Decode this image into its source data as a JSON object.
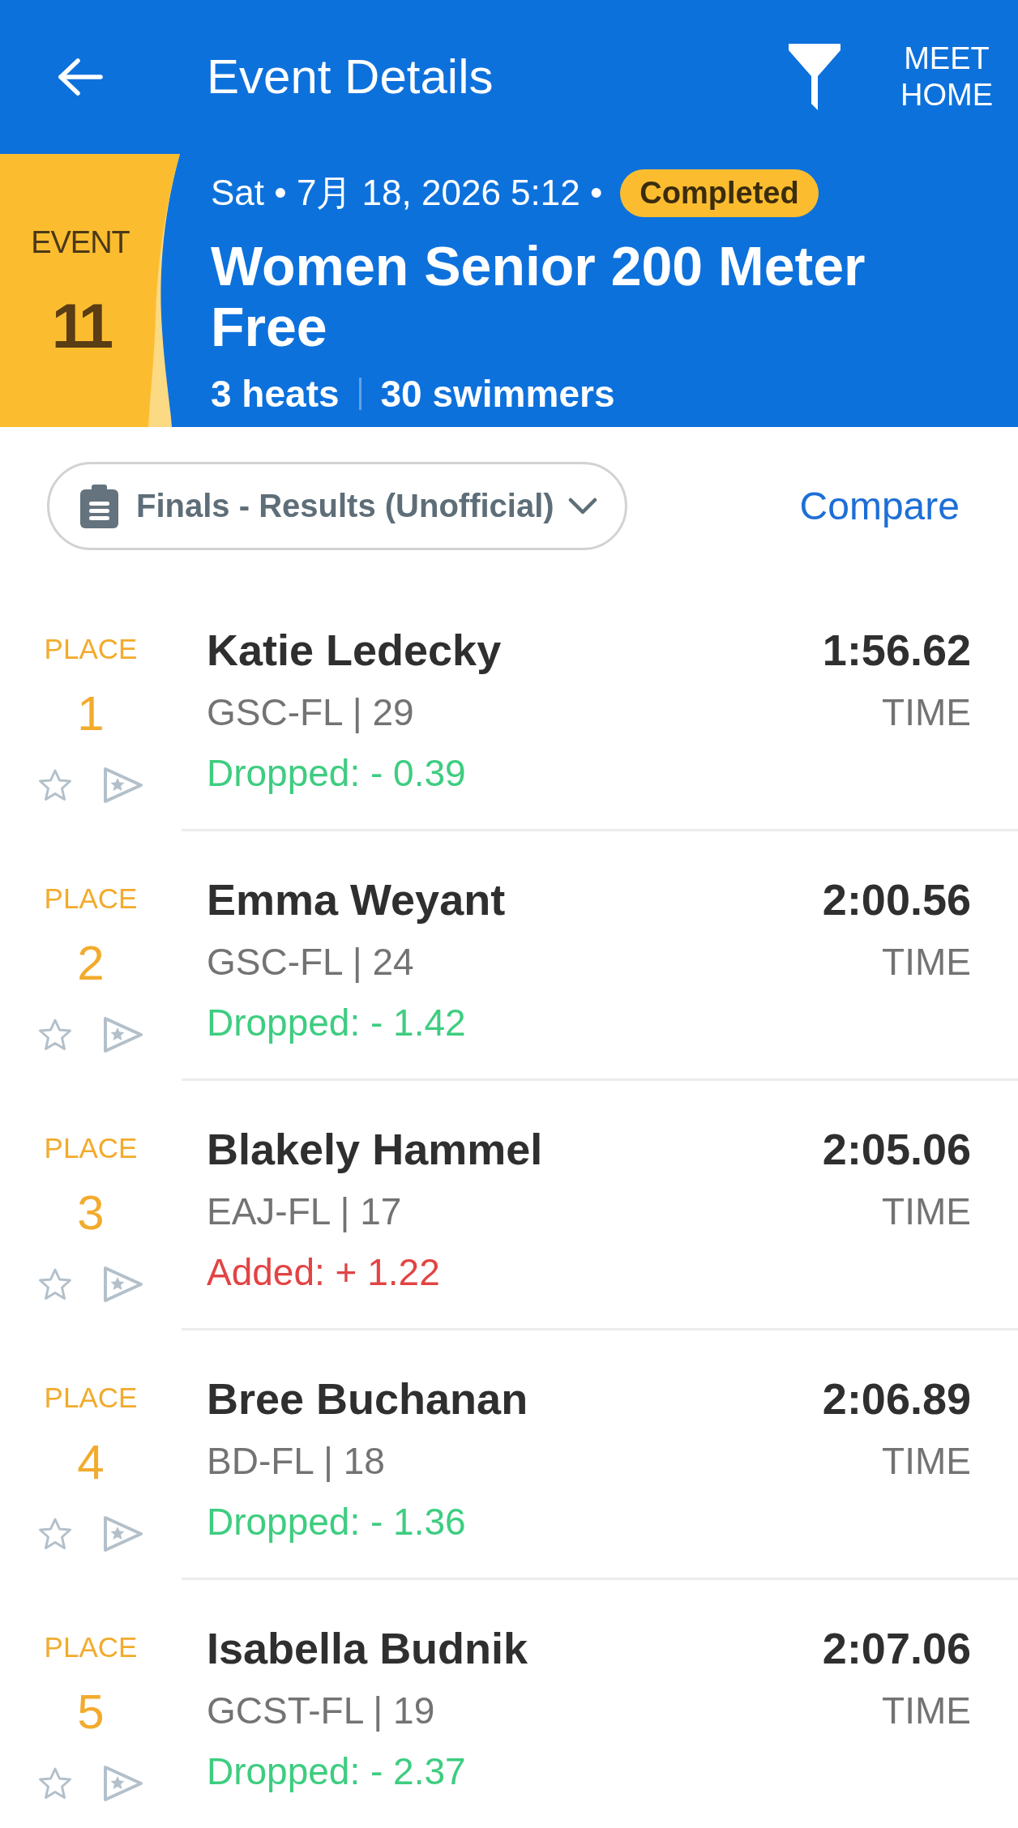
{
  "app_bar": {
    "title": "Event Details",
    "meet_home": "MEET HOME"
  },
  "event": {
    "label": "EVENT",
    "number": "11",
    "date_line": "Sat • 7月 18, 2026 5:12 •",
    "status": {
      "label": "Completed",
      "kind": "completed"
    },
    "title": "Women Senior 200 Meter Free",
    "stats": [
      "3 heats",
      "30 swimmers"
    ]
  },
  "toolbar": {
    "session": "Finals - Results (Unofficial)",
    "compare": "Compare"
  },
  "results": [
    {
      "place_label": "PLACE",
      "place": "1",
      "favorite": false,
      "name": "Katie Ledecky",
      "team": "GSC-FL | 29",
      "change": {
        "kind": "dropped",
        "text": "Dropped: - 0.39"
      },
      "time": "1:56.62",
      "time_label": "TIME"
    },
    {
      "place_label": "PLACE",
      "place": "2",
      "favorite": false,
      "name": "Emma Weyant",
      "team": "GSC-FL | 24",
      "change": {
        "kind": "dropped",
        "text": "Dropped: - 1.42"
      },
      "time": "2:00.56",
      "time_label": "TIME"
    },
    {
      "place_label": "PLACE",
      "place": "3",
      "favorite": false,
      "name": "Blakely Hammel",
      "team": "EAJ-FL | 17",
      "change": {
        "kind": "added",
        "text": "Added: + 1.22"
      },
      "time": "2:05.06",
      "time_label": "TIME"
    },
    {
      "place_label": "PLACE",
      "place": "4",
      "favorite": false,
      "name": "Bree Buchanan",
      "team": "BD-FL | 18",
      "change": {
        "kind": "dropped",
        "text": "Dropped: - 1.36"
      },
      "time": "2:06.89",
      "time_label": "TIME"
    },
    {
      "place_label": "PLACE",
      "place": "5",
      "favorite": false,
      "name": "Isabella Budnik",
      "team": "GCST-FL | 19",
      "change": {
        "kind": "dropped",
        "text": "Dropped: - 2.37"
      },
      "time": "2:07.06",
      "time_label": "TIME"
    }
  ]
}
